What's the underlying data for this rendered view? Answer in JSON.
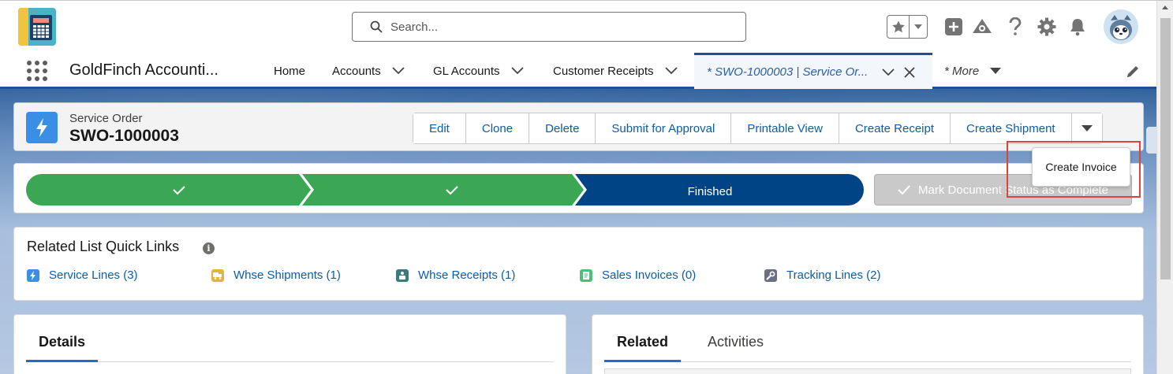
{
  "header": {
    "search_placeholder": "Search...",
    "app_logo_text": "GoldFinch",
    "icons": [
      "favorites-star-icon",
      "chevron-down-icon",
      "add-icon",
      "trailhead-icon",
      "help-icon",
      "setup-gear-icon",
      "notifications-bell-icon",
      "avatar"
    ]
  },
  "nav": {
    "app_name": "GoldFinch Accounti...",
    "items": [
      {
        "label": "Home",
        "has_menu": false
      },
      {
        "label": "Accounts",
        "has_menu": true
      },
      {
        "label": "GL Accounts",
        "has_menu": true
      },
      {
        "label": "Customer Receipts",
        "has_menu": true
      }
    ],
    "active_tab": {
      "label": "* SWO-1000003 | Service Or..."
    },
    "more_label": "* More"
  },
  "record": {
    "type": "Service Order",
    "name": "SWO-1000003",
    "actions": [
      "Edit",
      "Clone",
      "Delete",
      "Submit for Approval",
      "Printable View",
      "Create Receipt",
      "Create Shipment"
    ]
  },
  "dropdown": {
    "items": [
      "Create Invoice"
    ]
  },
  "path": {
    "stages": [
      {
        "label": "",
        "status": "complete"
      },
      {
        "label": "",
        "status": "complete"
      },
      {
        "label": "Finished",
        "status": "current"
      }
    ],
    "mark_button": "Mark Document Status as Complete",
    "colors": {
      "complete": "#3ba755",
      "current": "#014486"
    }
  },
  "quick_links": {
    "title": "Related List Quick Links",
    "links": [
      {
        "label": "Service Lines (3)",
        "icon": "lightning-icon",
        "color": "#3a8ee6"
      },
      {
        "label": "Whse Shipments (1)",
        "icon": "truck-icon",
        "color": "#e3b43c"
      },
      {
        "label": "Whse Receipts (1)",
        "icon": "receipt-icon",
        "color": "#3d7a80"
      },
      {
        "label": "Sales Invoices (0)",
        "icon": "invoice-icon",
        "color": "#4bc076"
      },
      {
        "label": "Tracking Lines (2)",
        "icon": "wrench-icon",
        "color": "#6b6f86"
      }
    ]
  },
  "details": {
    "tab_label": "Details"
  },
  "related": {
    "tabs": [
      "Related",
      "Activities"
    ]
  }
}
